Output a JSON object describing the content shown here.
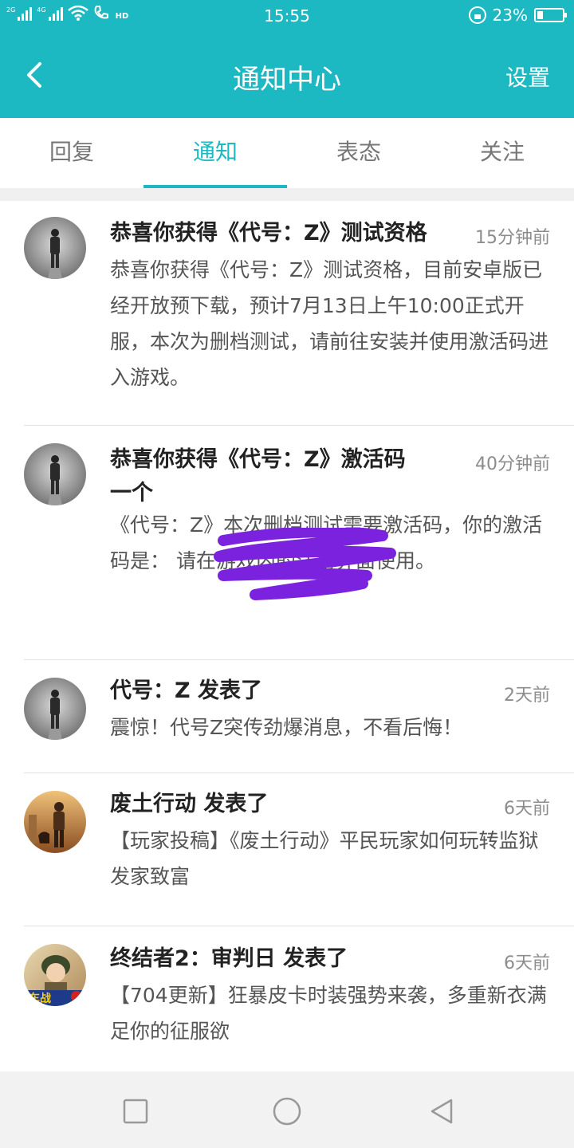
{
  "status_bar": {
    "network1": "2G",
    "network2": "4G",
    "hd": "HD",
    "time": "15:55",
    "battery_percent_label": "23%",
    "battery_level": 0.23
  },
  "header": {
    "title": "通知中心",
    "settings_label": "设置"
  },
  "tabs": [
    {
      "label": "回复",
      "active": false
    },
    {
      "label": "通知",
      "active": true
    },
    {
      "label": "表态",
      "active": false
    },
    {
      "label": "关注",
      "active": false
    }
  ],
  "notifications": [
    {
      "title": "恭喜你获得《代号：Z》测试资格",
      "time": "15分钟前",
      "body": "恭喜你获得《代号：Z》测试资格，目前安卓版已经开放预下载，预计7月13日上午10:00正式开服，本次为删档测试，请前往安装并使用激活码进入游戏。",
      "avatar_icon": "survivor-avatar-icon"
    },
    {
      "title": "恭喜你获得《代号：Z》激活码一个",
      "time": "40分钟前",
      "body": "《代号：Z》本次删档测试需要激活码，你的激活码是：                    请在游戏内的注册界面使用。",
      "avatar_icon": "survivor-avatar-icon"
    },
    {
      "title": "代号：Z 发表了",
      "time": "2天前",
      "body": "震惊！代号Z突传劲爆消息，不看后悔！",
      "avatar_icon": "survivor-avatar-icon"
    },
    {
      "title": "废土行动 发表了",
      "time": "6天前",
      "body": "【玩家投稿】《废土行动》平民玩家如何玩转监狱 发家致富",
      "avatar_icon": "wasteland-avatar-icon"
    },
    {
      "title": "终结者2：审判日 发表了",
      "time": "6天前",
      "body": "【704更新】狂暴皮卡时装强势来袭，多重新衣满足你的征服欲",
      "avatar_icon": "terminator-avatar-icon",
      "avatar_text": "车战"
    }
  ],
  "colors": {
    "accent": "#1cb9c3",
    "scribble": "#7a22dd"
  }
}
